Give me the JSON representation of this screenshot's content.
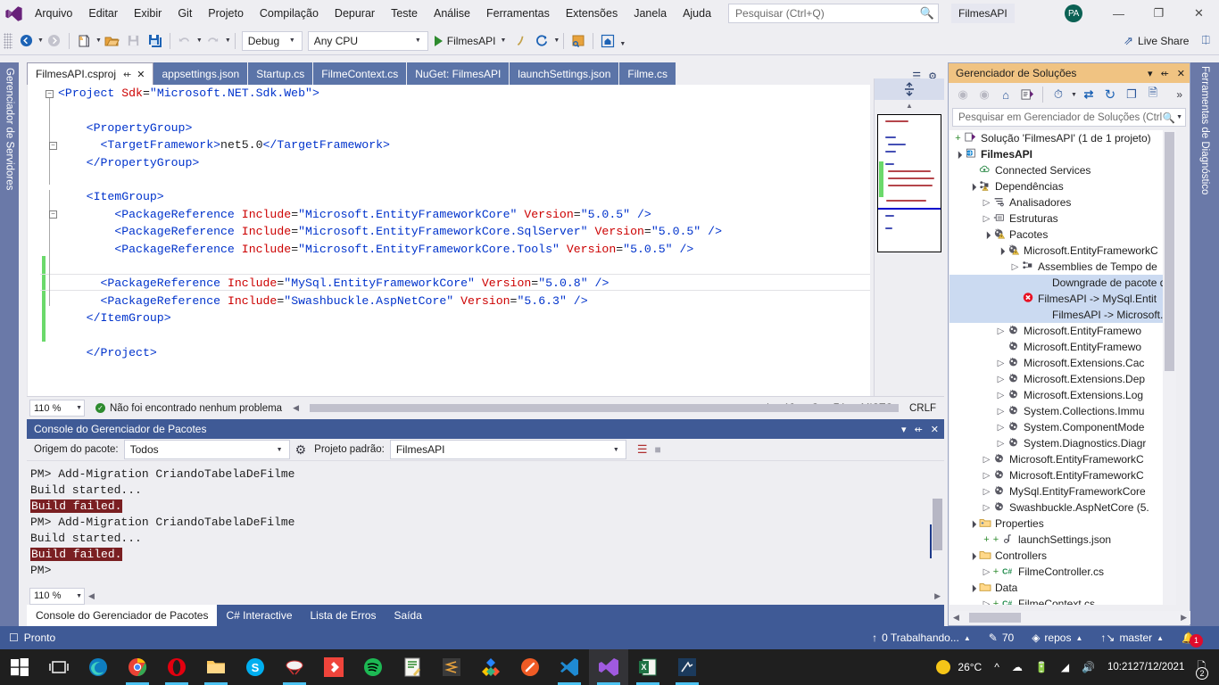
{
  "window": {
    "menu": [
      "Arquivo",
      "Editar",
      "Exibir",
      "Git",
      "Projeto",
      "Compilação",
      "Depurar",
      "Teste",
      "Análise",
      "Ferramentas",
      "Extensões",
      "Janela",
      "Ajuda"
    ],
    "search_placeholder": "Pesquisar (Ctrl+Q)",
    "project_chip": "FilmesAPI",
    "avatar_initials": "PA",
    "minimize": "—",
    "restore": "❐",
    "close": "✕"
  },
  "toolbar": {
    "config": "Debug",
    "platform": "Any CPU",
    "run_target": "FilmesAPI",
    "live_share": "Live Share"
  },
  "docks": {
    "left_label": "Gerenciador de Servidores",
    "right_label": "Ferramentas de Diagnóstico"
  },
  "editor": {
    "tabs": [
      {
        "label": "FilmesAPI.csproj",
        "active": true,
        "pin": "⇷",
        "close": "✕"
      },
      {
        "label": "appsettings.json",
        "active": false
      },
      {
        "label": "Startup.cs",
        "active": false
      },
      {
        "label": "FilmeContext.cs",
        "active": false
      },
      {
        "label": "NuGet: FilmesAPI",
        "active": false
      },
      {
        "label": "launchSettings.json",
        "active": false
      },
      {
        "label": "Filme.cs",
        "active": false
      }
    ],
    "code_lines": [
      "<Project Sdk=\"Microsoft.NET.Sdk.Web\">",
      "",
      "  <PropertyGroup>",
      "    <TargetFramework>net5.0</TargetFramework>",
      "  </PropertyGroup>",
      "",
      "  <ItemGroup>",
      "      <PackageReference Include=\"Microsoft.EntityFrameworkCore\" Version=\"5.0.5\" />",
      "      <PackageReference Include=\"Microsoft.EntityFrameworkCore.SqlServer\" Version=\"5.0.5\" />",
      "      <PackageReference Include=\"Microsoft.EntityFrameworkCore.Tools\" Version=\"5.0.5\" />",
      "",
      "    <PackageReference Include=\"MySql.EntityFrameworkCore\" Version=\"5.0.8\" />",
      "    <PackageReference Include=\"Swashbuckle.AspNetCore\" Version=\"5.6.3\" />",
      "  </ItemGroup>",
      "",
      "  </Project>"
    ],
    "status": {
      "zoom": "110 %",
      "problems": "Não foi encontrado nenhum problema",
      "line": "Ln: 13",
      "col": "Car: 74",
      "mode": "MISTO",
      "eol": "CRLF"
    }
  },
  "package_console": {
    "title": "Console do Gerenciador de Pacotes",
    "source_label": "Origem do pacote:",
    "source_value": "Todos",
    "project_label": "Projeto padrão:",
    "project_value": "FilmesAPI",
    "output": [
      {
        "text": "PM> Add-Migration CriandoTabelaDeFilme",
        "style": "normal"
      },
      {
        "text": "Build started...",
        "style": "normal"
      },
      {
        "text": "Build failed.",
        "style": "failed"
      },
      {
        "text": "PM> Add-Migration CriandoTabelaDeFilme",
        "style": "normal"
      },
      {
        "text": "Build started...",
        "style": "normal"
      },
      {
        "text": "Build failed.",
        "style": "failed"
      },
      {
        "text": "PM>",
        "style": "normal"
      }
    ],
    "zoom": "110 %",
    "tabs": [
      {
        "label": "Console do Gerenciador de Pacotes",
        "active": true
      },
      {
        "label": "C# Interactive",
        "active": false
      },
      {
        "label": "Lista de Erros",
        "active": false
      },
      {
        "label": "Saída",
        "active": false
      }
    ]
  },
  "solution_explorer": {
    "title": "Gerenciador de Soluções",
    "search_placeholder": "Pesquisar em Gerenciador de Soluções (Ctrl",
    "tree": [
      {
        "indent": 0,
        "arrow": "+",
        "icon": "solution",
        "label": "Solução 'FilmesAPI' (1 de 1 projeto)",
        "bold": false
      },
      {
        "indent": 0,
        "arrow": "▲",
        "icon": "project",
        "label": "FilmesAPI",
        "bold": true
      },
      {
        "indent": 1,
        "arrow": "",
        "icon": "cloud",
        "label": "Connected Services",
        "bold": false
      },
      {
        "indent": 1,
        "arrow": "▲",
        "icon": "deps-warn",
        "label": "Dependências",
        "bold": false
      },
      {
        "indent": 2,
        "arrow": "▶",
        "icon": "analyzer",
        "label": "Analisadores",
        "bold": false
      },
      {
        "indent": 2,
        "arrow": "▶",
        "icon": "framework",
        "label": "Estruturas",
        "bold": false
      },
      {
        "indent": 2,
        "arrow": "▲",
        "icon": "pkg-warn",
        "label": "Pacotes",
        "bold": false
      },
      {
        "indent": 3,
        "arrow": "▲",
        "icon": "pkg-warn",
        "label": "Microsoft.EntityFrameworkC",
        "bold": false
      },
      {
        "indent": 4,
        "arrow": "▶",
        "icon": "assembly",
        "label": "Assemblies de Tempo de",
        "bold": false
      },
      {
        "indent": 5,
        "arrow": "",
        "icon": "",
        "label": "Downgrade de pacote det",
        "bold": false,
        "selected": true
      },
      {
        "indent": 4,
        "arrow": "",
        "icon": "error",
        "label": "FilmesAPI -> MySql.Entit",
        "bold": false,
        "selected": true
      },
      {
        "indent": 5,
        "arrow": "",
        "icon": "",
        "label": "FilmesAPI -> Microsoft.E",
        "bold": false,
        "selected": true
      },
      {
        "indent": 3,
        "arrow": "▶",
        "icon": "pkg",
        "label": "Microsoft.EntityFramewo",
        "bold": false
      },
      {
        "indent": 3,
        "arrow": "",
        "icon": "pkg",
        "label": "Microsoft.EntityFramewo",
        "bold": false
      },
      {
        "indent": 3,
        "arrow": "▶",
        "icon": "pkg",
        "label": "Microsoft.Extensions.Cac",
        "bold": false
      },
      {
        "indent": 3,
        "arrow": "▶",
        "icon": "pkg",
        "label": "Microsoft.Extensions.Dep",
        "bold": false
      },
      {
        "indent": 3,
        "arrow": "▶",
        "icon": "pkg",
        "label": "Microsoft.Extensions.Log",
        "bold": false
      },
      {
        "indent": 3,
        "arrow": "▶",
        "icon": "pkg",
        "label": "System.Collections.Immu",
        "bold": false
      },
      {
        "indent": 3,
        "arrow": "▶",
        "icon": "pkg",
        "label": "System.ComponentMode",
        "bold": false
      },
      {
        "indent": 3,
        "arrow": "▶",
        "icon": "pkg",
        "label": "System.Diagnostics.Diagr",
        "bold": false
      },
      {
        "indent": 2,
        "arrow": "▶",
        "icon": "pkg",
        "label": "Microsoft.EntityFrameworkC",
        "bold": false
      },
      {
        "indent": 2,
        "arrow": "▶",
        "icon": "pkg",
        "label": "Microsoft.EntityFrameworkC",
        "bold": false
      },
      {
        "indent": 2,
        "arrow": "▶",
        "icon": "pkg",
        "label": "MySql.EntityFrameworkCore",
        "bold": false
      },
      {
        "indent": 2,
        "arrow": "▶",
        "icon": "pkg",
        "label": "Swashbuckle.AspNetCore (5.",
        "bold": false
      },
      {
        "indent": 1,
        "arrow": "▲",
        "icon": "folder-props",
        "label": "Properties",
        "bold": false
      },
      {
        "indent": 2,
        "arrow": "+",
        "icon": "json",
        "label": "launchSettings.json",
        "bold": false
      },
      {
        "indent": 1,
        "arrow": "▲",
        "icon": "folder",
        "label": "Controllers",
        "bold": false
      },
      {
        "indent": 2,
        "arrow": "▶+",
        "icon": "cs",
        "label": "FilmeController.cs",
        "bold": false
      },
      {
        "indent": 1,
        "arrow": "▲",
        "icon": "folder",
        "label": "Data",
        "bold": false
      },
      {
        "indent": 2,
        "arrow": "▶+",
        "icon": "cs",
        "label": "FilmeContext.cs",
        "bold": false
      }
    ]
  },
  "status_bar": {
    "ready": "Pronto",
    "work": "0 Trabalhando...",
    "pending": "70",
    "repo": "repos",
    "branch": "master",
    "error_count": "1"
  },
  "taskbar": {
    "weather_temp": "26°C",
    "time": "10:21",
    "date": "27/12/2021",
    "notif_count": "2"
  }
}
